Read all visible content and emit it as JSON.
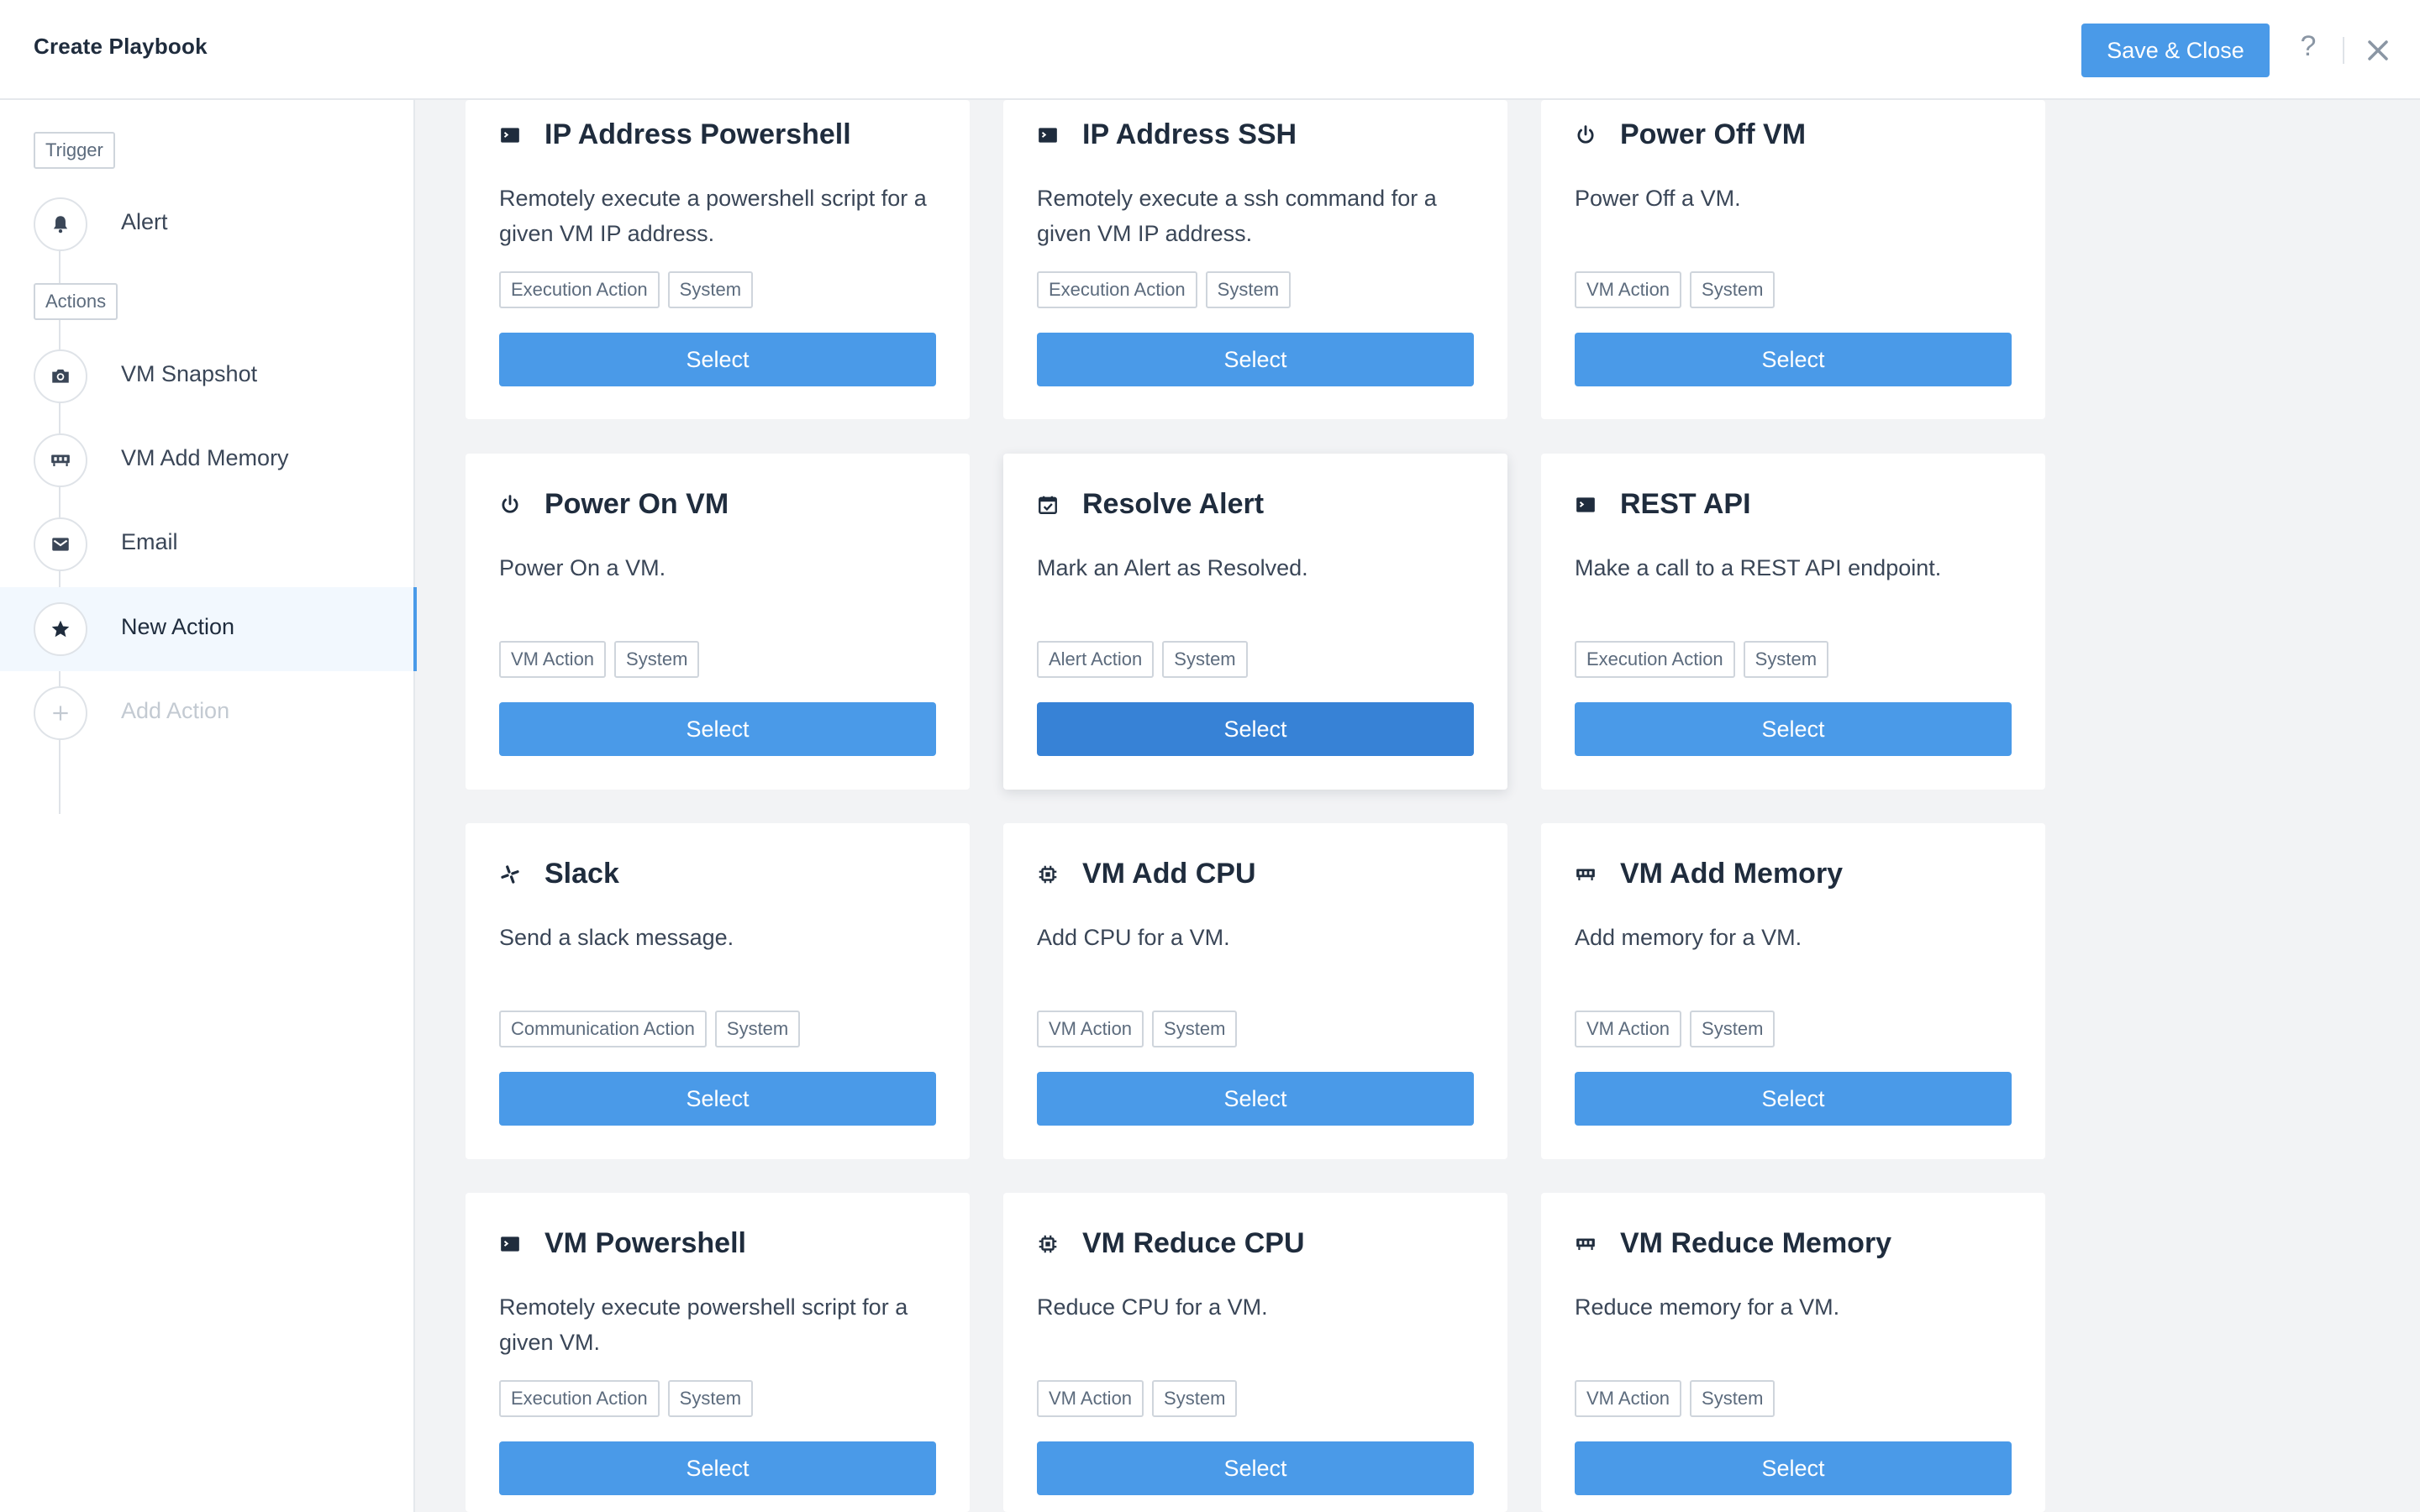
{
  "header": {
    "title": "Create Playbook",
    "save_label": "Save & Close",
    "help_label": "?"
  },
  "sidebar": {
    "trigger_tag": "Trigger",
    "actions_tag": "Actions",
    "items": [
      {
        "label": "Alert",
        "icon": "bell-icon"
      },
      {
        "label": "VM Snapshot",
        "icon": "camera-icon"
      },
      {
        "label": "VM Add Memory",
        "icon": "memory-icon"
      },
      {
        "label": "Email",
        "icon": "envelope-icon"
      },
      {
        "label": "New Action",
        "icon": "star-icon",
        "active": true
      },
      {
        "label": "Add Action",
        "icon": "plus-icon"
      }
    ]
  },
  "cards": [
    {
      "title": "IP Address Powershell",
      "icon": "terminal-icon",
      "description": "Remotely execute a powershell script for a given VM IP address.",
      "tags": [
        "Execution Action",
        "System"
      ],
      "button": "Select"
    },
    {
      "title": "IP Address SSH",
      "icon": "terminal-icon",
      "description": "Remotely execute a ssh command for a given VM IP address.",
      "tags": [
        "Execution Action",
        "System"
      ],
      "button": "Select"
    },
    {
      "title": "Power Off VM",
      "icon": "power-icon",
      "description": "Power Off a VM.",
      "tags": [
        "VM Action",
        "System"
      ],
      "button": "Select"
    },
    {
      "title": "Power On VM",
      "icon": "power-icon",
      "description": "Power On a VM.",
      "tags": [
        "VM Action",
        "System"
      ],
      "button": "Select"
    },
    {
      "title": "Resolve Alert",
      "icon": "calendar-check-icon",
      "description": "Mark an Alert as Resolved.",
      "tags": [
        "Alert Action",
        "System"
      ],
      "button": "Select"
    },
    {
      "title": "REST API",
      "icon": "terminal-icon",
      "description": "Make a call to a REST API endpoint.",
      "tags": [
        "Execution Action",
        "System"
      ],
      "button": "Select"
    },
    {
      "title": "Slack",
      "icon": "slack-icon",
      "description": "Send a slack message.",
      "tags": [
        "Communication Action",
        "System"
      ],
      "button": "Select"
    },
    {
      "title": "VM Add CPU",
      "icon": "cpu-icon",
      "description": "Add CPU for a VM.",
      "tags": [
        "VM Action",
        "System"
      ],
      "button": "Select"
    },
    {
      "title": "VM Add Memory",
      "icon": "memory-icon",
      "description": "Add memory for a VM.",
      "tags": [
        "VM Action",
        "System"
      ],
      "button": "Select"
    },
    {
      "title": "VM Powershell",
      "icon": "terminal-icon",
      "description": "Remotely execute powershell script for a given VM.",
      "tags": [
        "Execution Action",
        "System"
      ],
      "button": "Select"
    },
    {
      "title": "VM Reduce CPU",
      "icon": "cpu-icon",
      "description": "Reduce CPU for a VM.",
      "tags": [
        "VM Action",
        "System"
      ],
      "button": "Select"
    },
    {
      "title": "VM Reduce Memory",
      "icon": "memory-icon",
      "description": "Reduce memory for a VM.",
      "tags": [
        "VM Action",
        "System"
      ],
      "button": "Select"
    }
  ],
  "colors": {
    "accent": "#4a9ae8",
    "accent_hover": "#3782d6",
    "text": "#1f2c3d",
    "background": "#f2f3f5"
  }
}
